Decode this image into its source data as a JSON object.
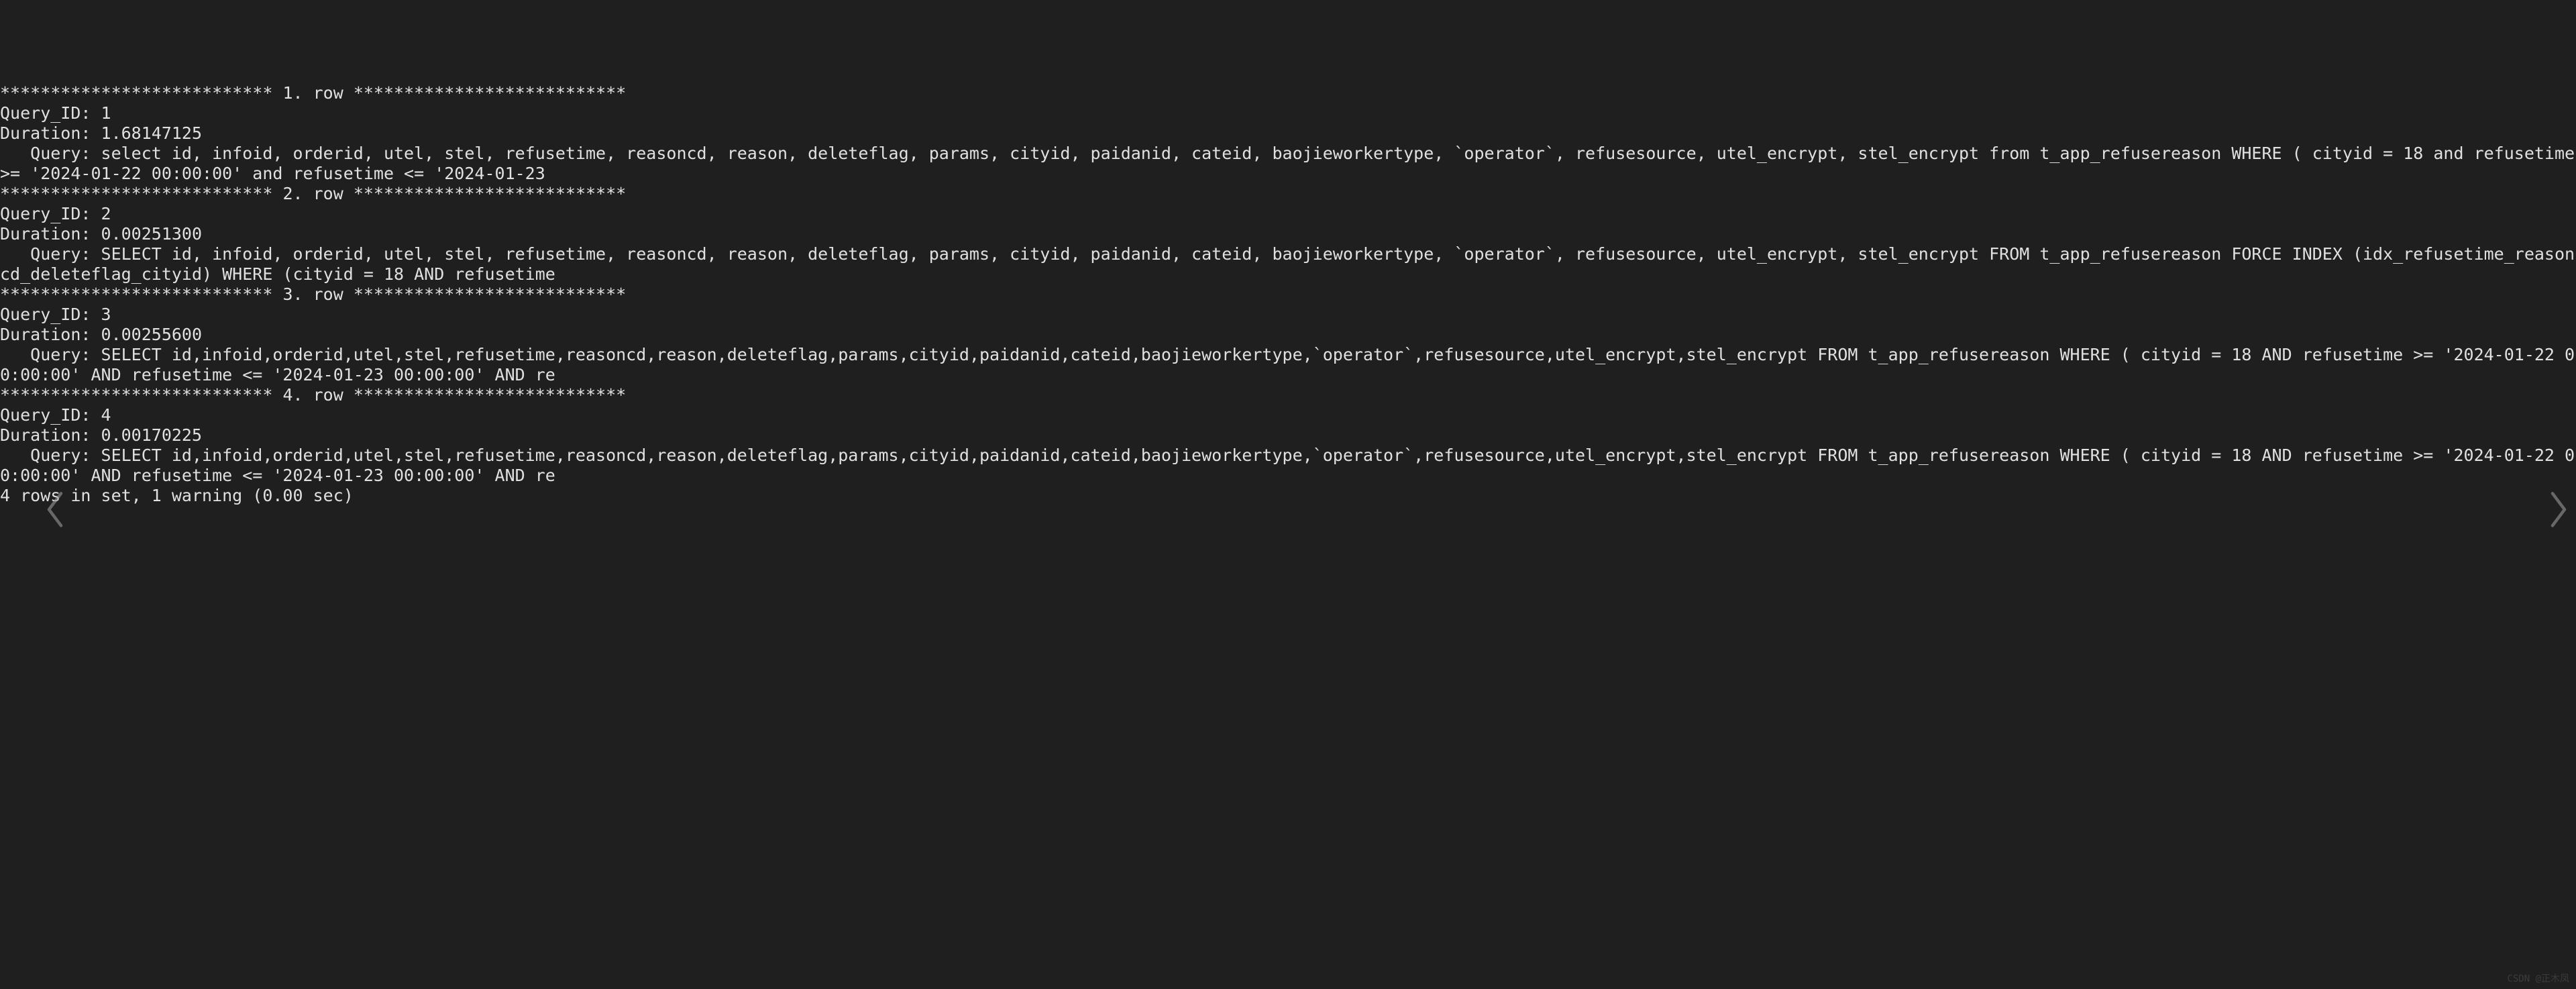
{
  "divider_prefix": "***************************",
  "divider_suffix": "***************************",
  "rows": [
    {
      "row_label": " 1. row ",
      "query_id_label": "Query_ID: ",
      "query_id": "1",
      "duration_label": "Duration: ",
      "duration": "1.68147125",
      "query_label": "   Query: ",
      "query": "select id, infoid, orderid, utel, stel, refusetime, reasoncd, reason, deleteflag, params, cityid, paidanid, cateid, baojieworkertype, `operator`, refusesource, utel_encrypt, stel_encrypt from t_app_refusereason WHERE ( cityid = 18 and refusetime >= '2024-01-22 00:00:00' and refusetime <= '2024-01-23"
    },
    {
      "row_label": " 2. row ",
      "query_id_label": "Query_ID: ",
      "query_id": "2",
      "duration_label": "Duration: ",
      "duration": "0.00251300",
      "query_label": "   Query: ",
      "query": "SELECT id, infoid, orderid, utel, stel, refusetime, reasoncd, reason, deleteflag, params, cityid, paidanid, cateid, baojieworkertype, `operator`, refusesource, utel_encrypt, stel_encrypt FROM t_app_refusereason FORCE INDEX (idx_refusetime_reasoncd_deleteflag_cityid) WHERE (cityid = 18 AND refusetime"
    },
    {
      "row_label": " 3. row ",
      "query_id_label": "Query_ID: ",
      "query_id": "3",
      "duration_label": "Duration: ",
      "duration": "0.00255600",
      "query_label": "   Query: ",
      "query": "SELECT id,infoid,orderid,utel,stel,refusetime,reasoncd,reason,deleteflag,params,cityid,paidanid,cateid,baojieworkertype,`operator`,refusesource,utel_encrypt,stel_encrypt FROM t_app_refusereason WHERE ( cityid = 18 AND refusetime >= '2024-01-22 00:00:00' AND refusetime <= '2024-01-23 00:00:00' AND re"
    },
    {
      "row_label": " 4. row ",
      "query_id_label": "Query_ID: ",
      "query_id": "4",
      "duration_label": "Duration: ",
      "duration": "0.00170225",
      "query_label": "   Query: ",
      "query": "SELECT id,infoid,orderid,utel,stel,refusetime,reasoncd,reason,deleteflag,params,cityid,paidanid,cateid,baojieworkertype,`operator`,refusesource,utel_encrypt,stel_encrypt FROM t_app_refusereason WHERE ( cityid = 18 AND refusetime >= '2024-01-22 00:00:00' AND refusetime <= '2024-01-23 00:00:00' AND re"
    }
  ],
  "footer": "4 rows in set, 1 warning (0.00 sec)",
  "watermark": "CSDN @正木凤",
  "nav": {
    "left": "‹",
    "right": "›"
  }
}
